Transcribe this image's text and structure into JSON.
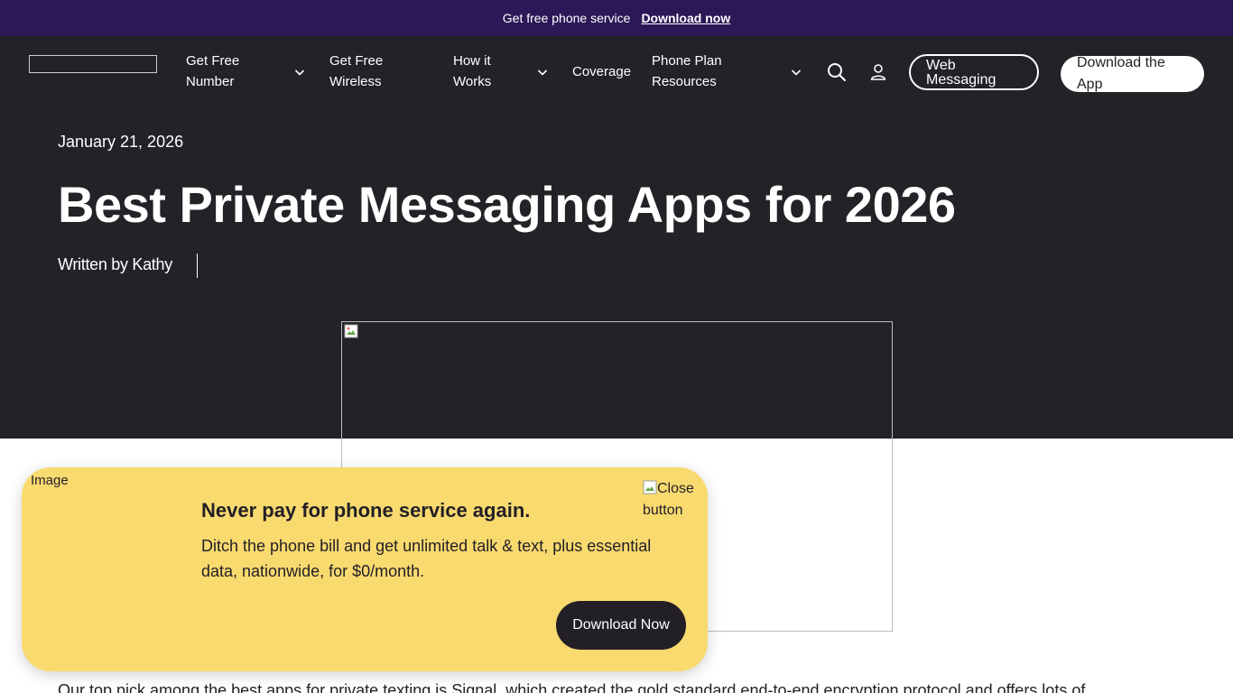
{
  "promo_bar": {
    "text": "Get free phone service",
    "link": "Download now"
  },
  "nav": {
    "logo_alt": "",
    "items": [
      {
        "label_line1": "Get Free",
        "label_line2": "Number",
        "has_dropdown": true
      },
      {
        "label_line1": "Get Free",
        "label_line2": "Wireless",
        "has_dropdown": false
      },
      {
        "label_line1": "How it",
        "label_line2": "Works",
        "has_dropdown": true
      },
      {
        "label": "Coverage",
        "has_dropdown": false
      },
      {
        "label_line1": "Phone Plan",
        "label_line2": "Resources",
        "has_dropdown": true
      }
    ],
    "icons": [
      "search-icon",
      "user-icon"
    ],
    "web_messaging": {
      "line1": "Web",
      "line2": "Messaging"
    },
    "download_app": {
      "line1": "Download the",
      "line2": "App"
    }
  },
  "article": {
    "date": "January 21, 2026",
    "title": "Best Private Messaging Apps for 2026",
    "byline": "Written by Kathy",
    "first_paragraph": "Our top pick among the best apps for private texting is Signal, which created the gold standard end-to-end encryption protocol and offers lots of"
  },
  "popup": {
    "image_alt": "Image",
    "close_alt": "Close button",
    "title": "Never pay for phone service again.",
    "body": "Ditch the phone bill and get unlimited talk & text, plus essential data, nationwide, for $0/month.",
    "cta": "Download Now"
  },
  "colors": {
    "promo_bg": "#2c1857",
    "header_bg": "#242127",
    "popup_bg": "#f8da6f",
    "cta_bg": "#231f26"
  }
}
